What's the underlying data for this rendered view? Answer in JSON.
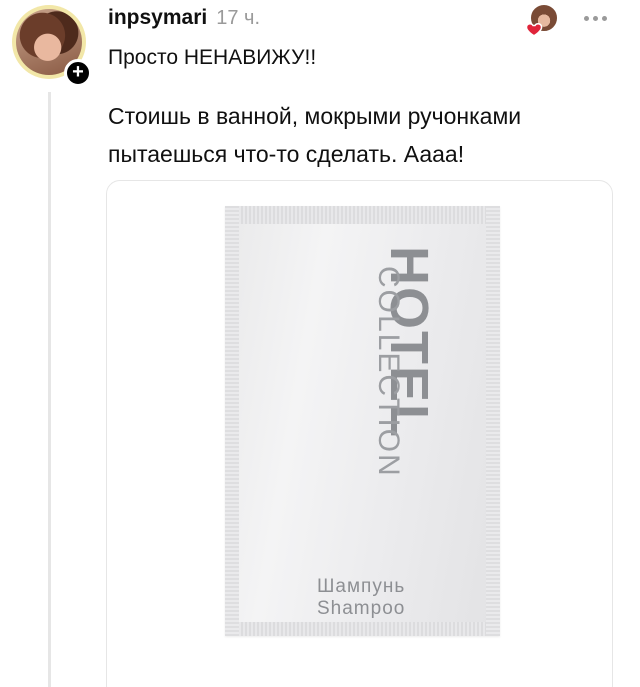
{
  "post": {
    "username": "inpsymari",
    "time": "17 ч.",
    "subtitle": "Просто НЕНАВИЖУ!!",
    "body": "Стоишь в ванной, мокрыми ручонками пытаешься что-то сделать. Аааа!"
  },
  "image": {
    "brand_main": "HOTEL",
    "brand_sub": "COLLECTION",
    "product_ru": "Шампунь",
    "product_en": "Shampoo"
  },
  "colors": {
    "heart": "#e0243a",
    "avatar_ring": "#f2e7a8",
    "muted": "#9a9a9a"
  },
  "icons": {
    "follow": "plus-icon",
    "like": "heart-icon",
    "more": "more-icon"
  }
}
